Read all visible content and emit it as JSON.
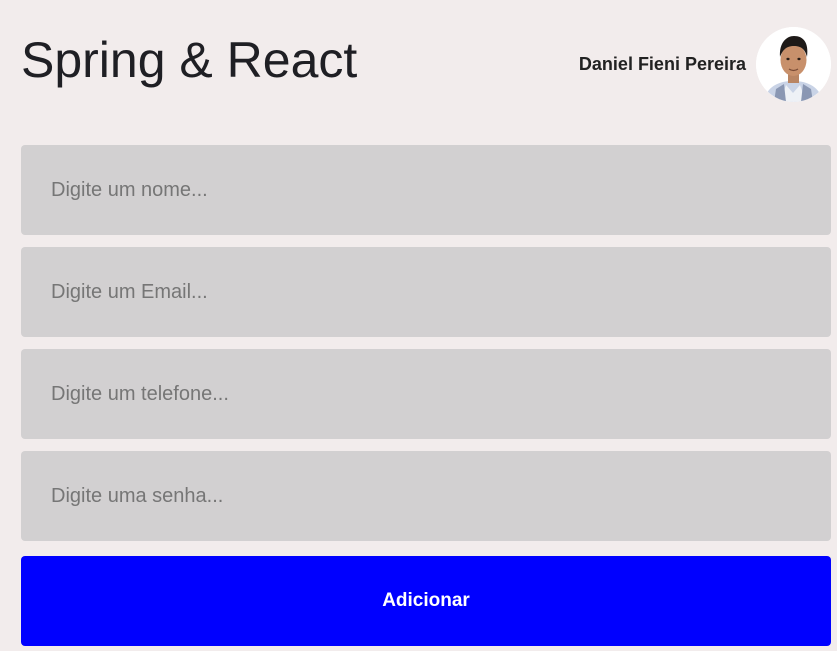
{
  "header": {
    "title": "Spring & React",
    "user_name": "Daniel Fieni Pereira",
    "avatar_icon": "user-avatar-photo"
  },
  "form": {
    "name_placeholder": "Digite um nome...",
    "email_placeholder": "Digite um Email...",
    "phone_placeholder": "Digite um telefone...",
    "password_placeholder": "Digite uma senha...",
    "submit_label": "Adicionar"
  },
  "colors": {
    "background": "#f2ecec",
    "input_background": "#d2d0d1",
    "button_background": "#0000ff",
    "button_text": "#ffffff"
  }
}
